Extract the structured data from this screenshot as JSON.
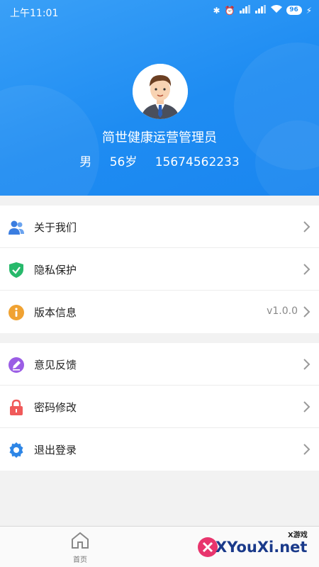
{
  "status_bar": {
    "time": "上午11:01",
    "battery": "96"
  },
  "profile": {
    "name": "简世健康运营管理员",
    "gender": "男",
    "age": "56岁",
    "phone": "15674562233"
  },
  "menu_group_1": [
    {
      "label": "关于我们",
      "icon": "users-icon",
      "color": "#3a7de0"
    },
    {
      "label": "隐私保护",
      "icon": "shield-check-icon",
      "color": "#27b96b"
    },
    {
      "label": "版本信息",
      "icon": "info-icon",
      "color": "#f0a232",
      "value": "v1.0.0"
    }
  ],
  "menu_group_2": [
    {
      "label": "意见反馈",
      "icon": "edit-icon",
      "color": "#9b5de5"
    },
    {
      "label": "密码修改",
      "icon": "lock-icon",
      "color": "#f05a5a"
    },
    {
      "label": "退出登录",
      "icon": "gear-icon",
      "color": "#2e86e6"
    }
  ],
  "tabbar": {
    "home_label": "首页"
  },
  "watermark": {
    "text": "XYouXi.net",
    "small": "X游戏"
  },
  "colors": {
    "header_blue": "#1e8cf2",
    "background": "#f2f2f2"
  }
}
